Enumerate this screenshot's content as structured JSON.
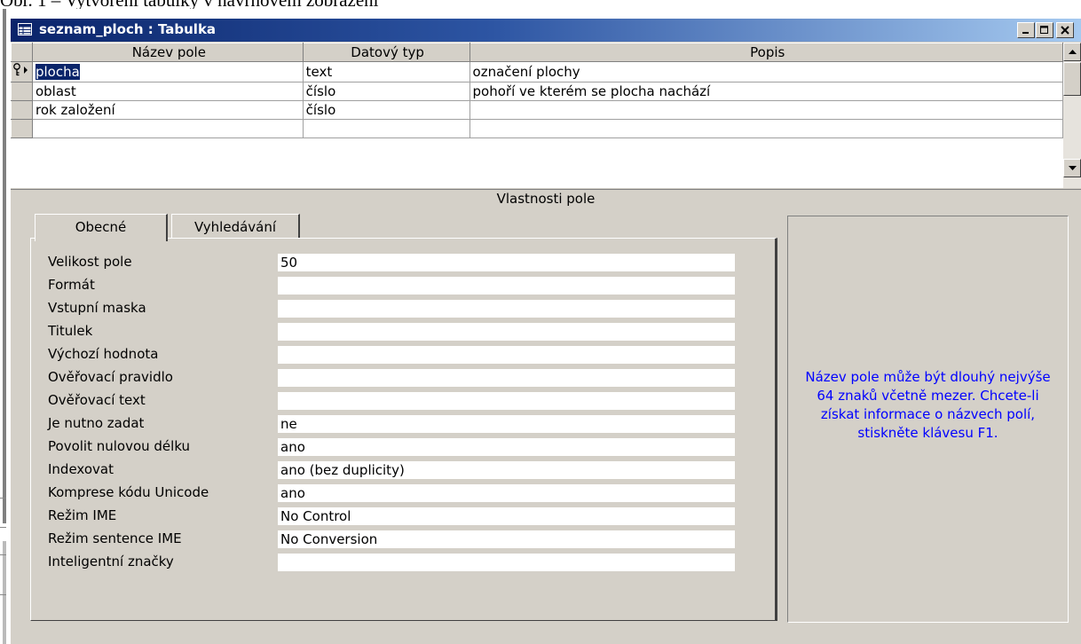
{
  "document": {
    "caption": "Obr. 1 – Vytvoření tabulky v návrhovém zobrazení"
  },
  "window": {
    "title": "seznam_ploch : Tabulka",
    "controls": {
      "minimize": "_",
      "maximize": "□",
      "close": "✕"
    },
    "title_gradient": [
      "#0a246a",
      "#a6caf0"
    ]
  },
  "fields_grid": {
    "headers": {
      "name": "Název pole",
      "type": "Datový typ",
      "description": "Popis"
    },
    "rows": [
      {
        "name": "plocha",
        "type": "text",
        "description": "označení plochy",
        "primary_key": true,
        "current": true
      },
      {
        "name": "oblast",
        "type": "číslo",
        "description": "pohoří ve kterém se plocha nachází"
      },
      {
        "name": "rok založení",
        "type": "číslo",
        "description": ""
      },
      {
        "name": "",
        "type": "",
        "description": ""
      }
    ]
  },
  "properties": {
    "section_title": "Vlastnosti pole",
    "tabs": [
      {
        "label": "Obecné",
        "active": true
      },
      {
        "label": "Vyhledávání",
        "active": false
      }
    ],
    "rows": [
      {
        "label": "Velikost pole",
        "value": "50"
      },
      {
        "label": "Formát",
        "value": ""
      },
      {
        "label": "Vstupní maska",
        "value": ""
      },
      {
        "label": "Titulek",
        "value": ""
      },
      {
        "label": "Výchozí hodnota",
        "value": ""
      },
      {
        "label": "Ověřovací pravidlo",
        "value": ""
      },
      {
        "label": "Ověřovací text",
        "value": ""
      },
      {
        "label": "Je nutno zadat",
        "value": "ne"
      },
      {
        "label": "Povolit nulovou délku",
        "value": "ano"
      },
      {
        "label": "Indexovat",
        "value": "ano (bez duplicity)"
      },
      {
        "label": "Komprese kódu Unicode",
        "value": "ano"
      },
      {
        "label": "Režim IME",
        "value": "No Control"
      },
      {
        "label": "Režim sentence IME",
        "value": "No Conversion"
      },
      {
        "label": "Inteligentní značky",
        "value": ""
      }
    ]
  },
  "help": {
    "text": "Název pole může být dlouhý nejvýše 64 znaků včetně mezer. Chcete-li získat informace o názvech polí, stiskněte klávesu F1.",
    "color": "#0000ff"
  },
  "icons": {
    "table": "table-icon",
    "primary_key": "key-icon",
    "row_selector": "triangle-right-icon",
    "scroll_up": "arrow-up-icon",
    "scroll_down": "arrow-down-icon"
  }
}
